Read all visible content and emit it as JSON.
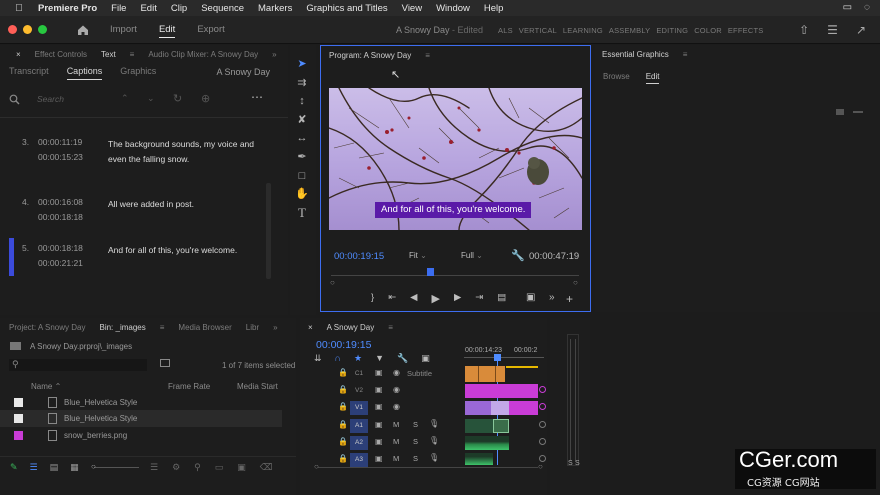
{
  "menubar": {
    "app": "Premiere Pro",
    "items": [
      "File",
      "Edit",
      "Clip",
      "Sequence",
      "Markers",
      "Graphics and Titles",
      "View",
      "Window",
      "Help"
    ]
  },
  "header": {
    "tabs": [
      "Import",
      "Edit",
      "Export"
    ],
    "active_tab": "Edit",
    "doc_title": "A Snowy Day",
    "doc_status": "- Edited",
    "workspaces": [
      "ALS",
      "VERTICAL",
      "LEARNING",
      "ASSEMBLY",
      "EDITING",
      "COLOR",
      "EFFECTS"
    ]
  },
  "left_panel": {
    "tabs": [
      "Effect Controls",
      "Text",
      "Audio Clip Mixer: A Snowy Day"
    ],
    "active": "Text",
    "subtabs": [
      "Transcript",
      "Captions",
      "Graphics"
    ],
    "active_subtab": "Captions",
    "sequence_name": "A Snowy Day",
    "search_placeholder": "Search",
    "captions": [
      {
        "num": "3.",
        "in": "00:00:11:19",
        "out": "00:00:15:23",
        "text": "The background sounds, my voice and even the falling snow."
      },
      {
        "num": "4.",
        "in": "00:00:16:08",
        "out": "00:00:18:18",
        "text": "All were added in post."
      },
      {
        "num": "5.",
        "in": "00:00:18:18",
        "out": "00:00:21:21",
        "text": "And for all of this, you're welcome."
      }
    ]
  },
  "program": {
    "title": "Program: A Snowy Day",
    "caption": "And for all of this, you're welcome.",
    "timecode": "00:00:19:15",
    "fit": "Fit",
    "quality": "Full",
    "duration": "00:00:47:19",
    "playhead_fraction": 0.4
  },
  "essential_graphics": {
    "title": "Essential Graphics",
    "tabs": [
      "Browse",
      "Edit"
    ],
    "active": "Edit"
  },
  "project": {
    "tabs": [
      "Project: A Snowy Day",
      "Bin: _images",
      "Media Browser",
      "Libr"
    ],
    "active": "Bin: _images",
    "path": "A Snowy Day.prproj\\_images",
    "count": "1 of 7 items selected",
    "columns": [
      "Name",
      "Frame Rate",
      "Media Start"
    ],
    "items": [
      {
        "name": "Blue_Helvetica Style",
        "swatch": "#e8e8e8"
      },
      {
        "name": "Blue_Helvetica Style",
        "swatch": "#e8e8e8"
      },
      {
        "name": "snow_berries.png",
        "swatch": "#c93cd6"
      }
    ]
  },
  "timeline": {
    "tab": "A Snowy Day",
    "timecode": "00:00:19:15",
    "ruler": [
      "00:00:14:23",
      "00:00:2"
    ],
    "tracks": [
      {
        "name": "C1",
        "label": "Subtitle"
      },
      {
        "name": "V2",
        "label": ""
      },
      {
        "name": "V1",
        "label": ""
      },
      {
        "name": "A1",
        "label": "M"
      },
      {
        "name": "A2",
        "label": "M"
      },
      {
        "name": "A3",
        "label": "M"
      }
    ]
  },
  "meters": {
    "labels": [
      "S",
      "S"
    ]
  },
  "watermark": {
    "brand": "CGer.com",
    "sub": "CG资源 CG网站"
  }
}
